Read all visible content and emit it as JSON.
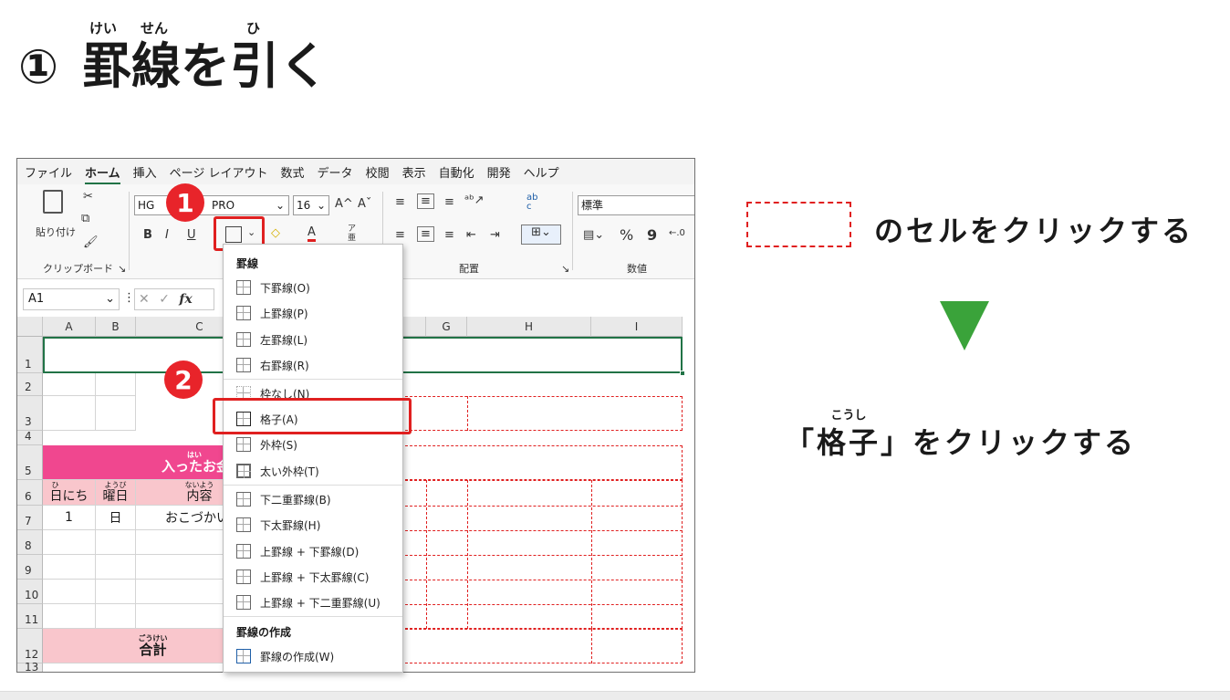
{
  "slide": {
    "number": "①",
    "title_chars": [
      {
        "char": "罫",
        "ruby": "けい"
      },
      {
        "char": "線",
        "ruby": "せん"
      },
      {
        "char": "を",
        "ruby": ""
      },
      {
        "char": "引",
        "ruby": "ひ"
      },
      {
        "char": "く",
        "ruby": ""
      }
    ]
  },
  "excel": {
    "menu": [
      "ファイル",
      "ホーム",
      "挿入",
      "ページ レイアウト",
      "数式",
      "データ",
      "校閲",
      "表示",
      "自動化",
      "開発",
      "ヘルプ"
    ],
    "ribbon": {
      "paste_label": "貼り付け",
      "clipboard_group": "クリップボード",
      "font_name": "HG創英角ポップ体 PRO",
      "font_name_visible_left": "HG",
      "font_name_visible_right": "PRO",
      "font_size": "16",
      "bold": "B",
      "italic": "I",
      "underline": "U",
      "grow_font": "A^",
      "shrink_font": "Aˇ",
      "font_color": "A",
      "phonetic": "ア亜",
      "wrap": "ab c",
      "align_group": "配置",
      "number_format": "標準",
      "number_group": "数値",
      "percent": "%",
      "comma": "9"
    },
    "name_box": "A1",
    "fx": "fx",
    "columns": [
      "A",
      "B",
      "C",
      "G",
      "H",
      "I"
    ],
    "rows": [
      "1",
      "2",
      "3",
      "4",
      "5",
      "6",
      "7",
      "8",
      "9",
      "10",
      "11",
      "12",
      "13"
    ],
    "cells": {
      "header_banner": "入ったお金",
      "header_banner_ruby": "はい",
      "col_day": "日にち",
      "col_day_ruby": "ひ",
      "col_weekday": "曜日",
      "col_weekday_ruby": "ようび",
      "col_content": "内容",
      "col_content_ruby": "ないよう",
      "r7_day": "1",
      "r7_weekday": "日",
      "r7_content": "おこづかい",
      "total": "合計",
      "total_ruby": "ごうけい"
    },
    "border_menu": {
      "section_border": "罫線",
      "items": [
        {
          "label": "下罫線(O)"
        },
        {
          "label": "上罫線(P)"
        },
        {
          "label": "左罫線(L)"
        },
        {
          "label": "右罫線(R)"
        },
        {
          "label": "枠なし(N)"
        },
        {
          "label": "格子(A)"
        },
        {
          "label": "外枠(S)"
        },
        {
          "label": "太い外枠(T)"
        },
        {
          "label": "下二重罫線(B)"
        },
        {
          "label": "下太罫線(H)"
        },
        {
          "label": "上罫線 + 下罫線(D)"
        },
        {
          "label": "上罫線 + 下太罫線(C)"
        },
        {
          "label": "上罫線 + 下二重罫線(U)"
        }
      ],
      "section_draw": "罫線の作成",
      "draw_item": "罫線の作成(W)"
    },
    "badges": [
      "1",
      "2"
    ]
  },
  "instructions": {
    "step1": "のセルをクリックする",
    "step2_open": "「",
    "step2_word": "格子",
    "step2_word_ruby": "こうし",
    "step2_close": "」をクリックする"
  },
  "colors": {
    "highlight_red": "#e02020",
    "badge_red": "#e8242a",
    "arrow_green": "#3aa33a",
    "header_pink": "#f0478f",
    "subheader_pink": "#f9c6cc",
    "excel_green": "#217346"
  }
}
